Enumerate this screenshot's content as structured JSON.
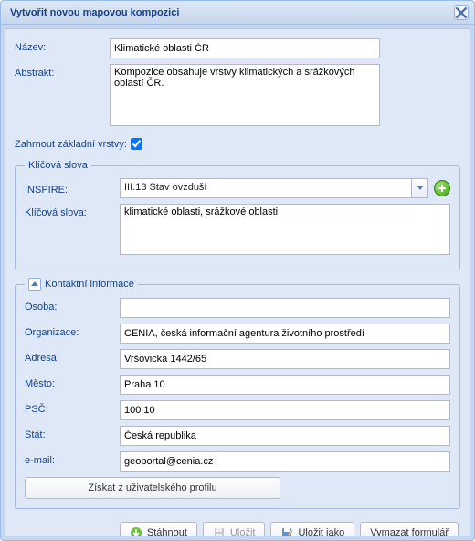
{
  "window": {
    "title": "Vytvořit novou mapovou kompozici"
  },
  "form": {
    "name_label": "Název:",
    "name_value": "Klimatické oblasti ČR",
    "abstract_label": "Abstrakt:",
    "abstract_value": "Kompozice obsahuje vrstvy klimatických a srážkových oblastí ČR.",
    "include_base_label": "Zahrnout základní vrstvy:",
    "include_base_checked": true
  },
  "keywords": {
    "legend": "Klíčová slova",
    "inspire_label": "INSPIRE:",
    "inspire_value": "III.13 Stav ovzduší",
    "keywords_label": "Klíčová slova:",
    "keywords_value": "klimatické oblasti, srážkové oblasti"
  },
  "contact": {
    "legend": "Kontaktní informace",
    "person_label": "Osoba:",
    "person_value": "",
    "org_label": "Organizace:",
    "org_value": "CENIA, česká informační agentura životního prostředí",
    "address_label": "Adresa:",
    "address_value": "Vršovická 1442/65",
    "city_label": "Město:",
    "city_value": "Praha 10",
    "zip_label": "PSČ:",
    "zip_value": "100 10",
    "country_label": "Stát:",
    "country_value": "Česká republika",
    "email_label": "e-mail:",
    "email_value": "geoportal@cenia.cz",
    "profile_button": "Získat z uživatelského profilu"
  },
  "buttons": {
    "download": "Stáhnout",
    "save": "Uložit",
    "save_as": "Uložit jako",
    "clear": "Vymazat formulář"
  }
}
